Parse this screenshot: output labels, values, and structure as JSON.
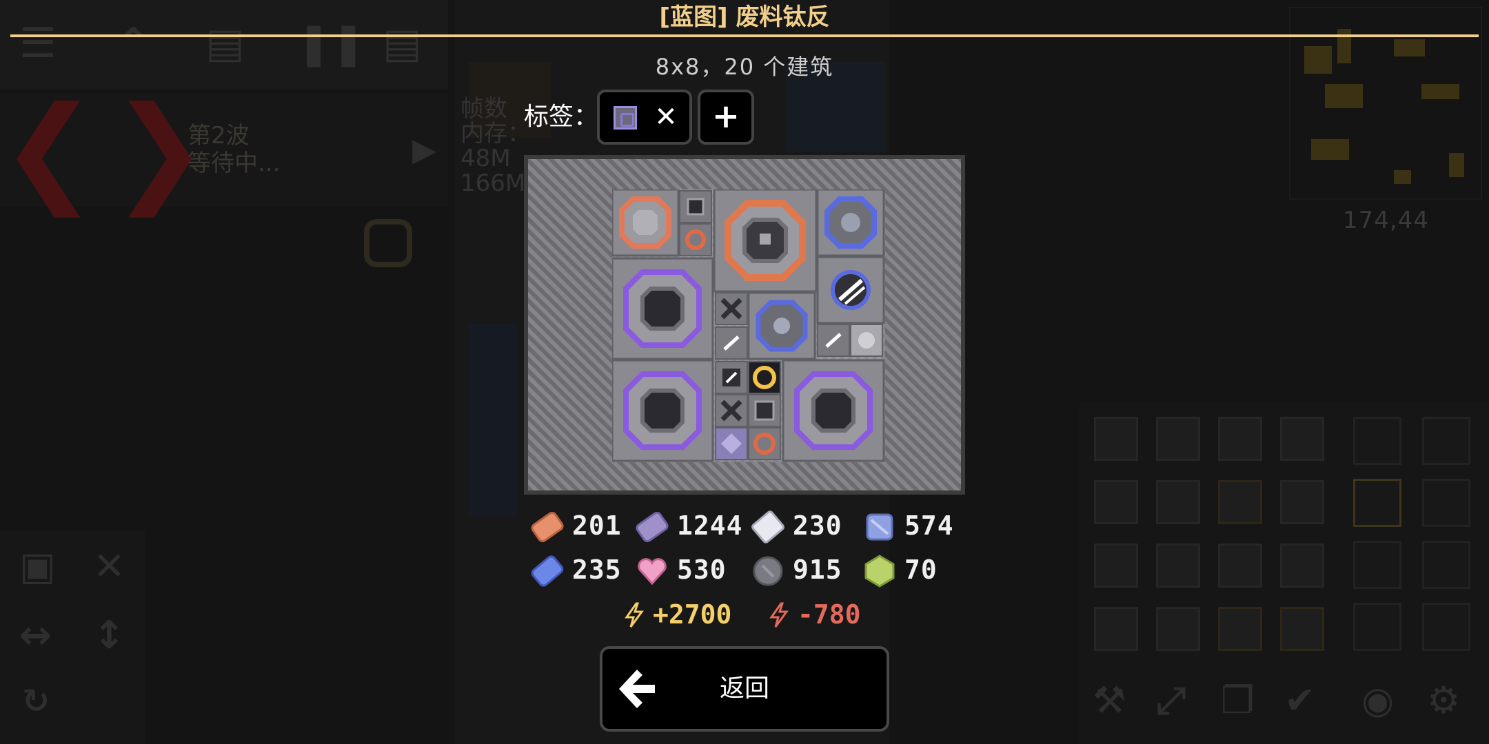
{
  "dialog": {
    "title": "[蓝图] 废料钛反",
    "subtitle": "8x8，20 个建筑",
    "tags_label": "标签：",
    "tag_remove_glyph": "✕",
    "tag_add_glyph": "+",
    "back_label": "返回"
  },
  "resources": [
    {
      "name": "copper",
      "color": "#e6916b",
      "value": "201"
    },
    {
      "name": "lead",
      "color": "#9f90c9",
      "value": "1244"
    },
    {
      "name": "metaglass",
      "color": "#e8e8f0",
      "value": "230"
    },
    {
      "name": "titanium",
      "color": "#8da1e3",
      "value": "574"
    },
    {
      "name": "plastanium-blue",
      "color": "#6b88e8",
      "value": "235"
    },
    {
      "name": "phase-fabric",
      "color": "#f1a0c7",
      "value": "530"
    },
    {
      "name": "silicon",
      "color": "#7a7a82",
      "value": "915"
    },
    {
      "name": "thorium-green",
      "color": "#b9d36a",
      "value": "70"
    }
  ],
  "power": {
    "produced": "+2700",
    "consumed": "-780",
    "produced_color": "#f5cf6a",
    "consumed_color": "#e56a5c"
  },
  "background": {
    "wave_label": "第2波",
    "wave_status": "等待中...",
    "stats_line1": "帧数",
    "stats_line2": "内存：",
    "stats_line3": "48M",
    "stats_line4": "166M",
    "coords": "174,44"
  }
}
